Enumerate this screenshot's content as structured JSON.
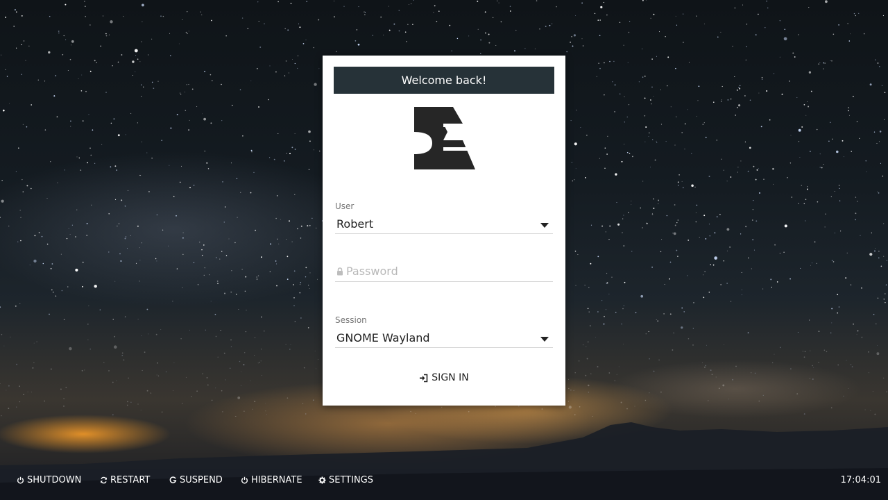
{
  "login": {
    "header": "Welcome back!",
    "logo_icon": "greeter-logo-icon",
    "user_label": "User",
    "user_value": "Robert",
    "password_placeholder": "Password",
    "session_label": "Session",
    "session_value": "GNOME Wayland",
    "signin_label": "SIGN IN",
    "signin_icon": "sign-in-icon",
    "header_color": "#263238"
  },
  "actions": [
    {
      "label": "SHUTDOWN",
      "icon": "power-icon"
    },
    {
      "label": "RESTART",
      "icon": "refresh-icon"
    },
    {
      "label": "SUSPEND",
      "icon": "suspend-icon"
    },
    {
      "label": "HIBERNATE",
      "icon": "power-icon"
    },
    {
      "label": "SETTINGS",
      "icon": "gear-icon"
    }
  ],
  "clock": "17:04:01"
}
